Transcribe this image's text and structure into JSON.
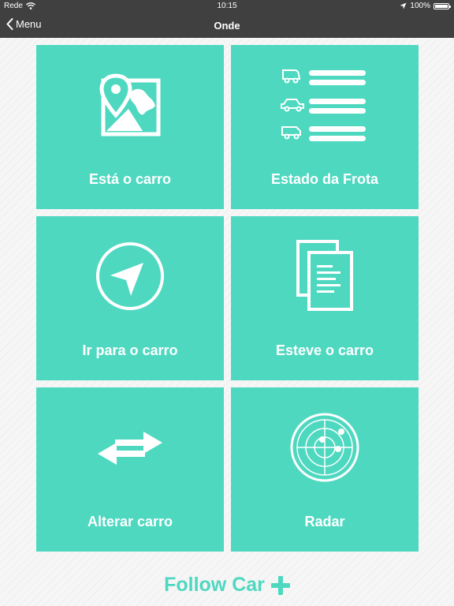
{
  "status_bar": {
    "carrier": "Rede",
    "wifi_icon": "wifi-icon",
    "time": "10:15",
    "location_icon": "location-arrow-icon",
    "battery_text": "100%",
    "battery_level": 1.0
  },
  "nav": {
    "back_label": "Menu",
    "back_icon": "chevron-left-icon",
    "title": "Onde"
  },
  "tiles": [
    {
      "label": "Está o carro",
      "icon": "map-pin-icon"
    },
    {
      "label": "Estado da Frota",
      "icon": "fleet-list-icon"
    },
    {
      "label": "Ir para o carro",
      "icon": "compass-icon"
    },
    {
      "label": "Esteve o carro",
      "icon": "documents-icon"
    },
    {
      "label": "Alterar carro",
      "icon": "swap-arrows-icon"
    },
    {
      "label": "Radar",
      "icon": "radar-icon"
    }
  ],
  "brand": {
    "text": "Follow Car",
    "icon": "plus-icon"
  },
  "colors": {
    "bars": "#404040",
    "accent": "#4ed8c0",
    "background": "#f6f6f6"
  }
}
